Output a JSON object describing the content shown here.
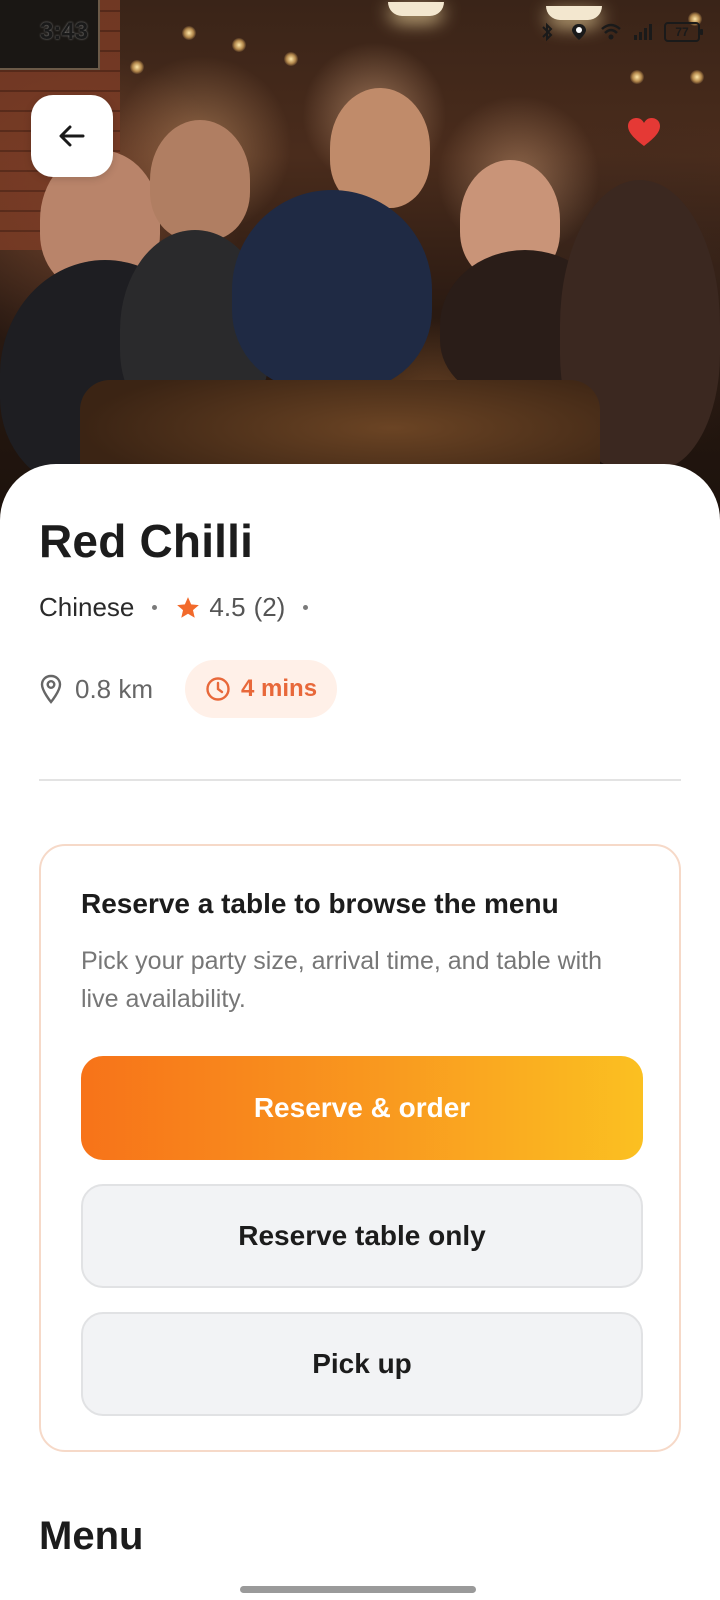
{
  "status_bar": {
    "time": "3:43",
    "battery": "77",
    "icons": [
      "bluetooth-icon",
      "location-icon",
      "wifi-icon",
      "signal-icon"
    ]
  },
  "hero": {
    "description_icon": "restaurant-photo"
  },
  "restaurant": {
    "name": "Red Chilli",
    "cuisine": "Chinese",
    "rating": "4.5",
    "rating_count": "(2)",
    "distance": "0.8 km",
    "eta": "4 mins",
    "favorite": true
  },
  "reserve_card": {
    "title": "Reserve a table to browse the menu",
    "description": "Pick your party size, arrival time, and table with live availability.",
    "primary_button": "Reserve & order",
    "secondary_button": "Reserve table only",
    "pickup_button": "Pick up"
  },
  "menu": {
    "heading": "Menu"
  },
  "colors": {
    "accent": "#f77319",
    "accent_end": "#fbc021",
    "badge_bg": "#fff0e8",
    "badge_text": "#e8683a",
    "favorite": "#e53935",
    "star": "#f26a2b"
  }
}
